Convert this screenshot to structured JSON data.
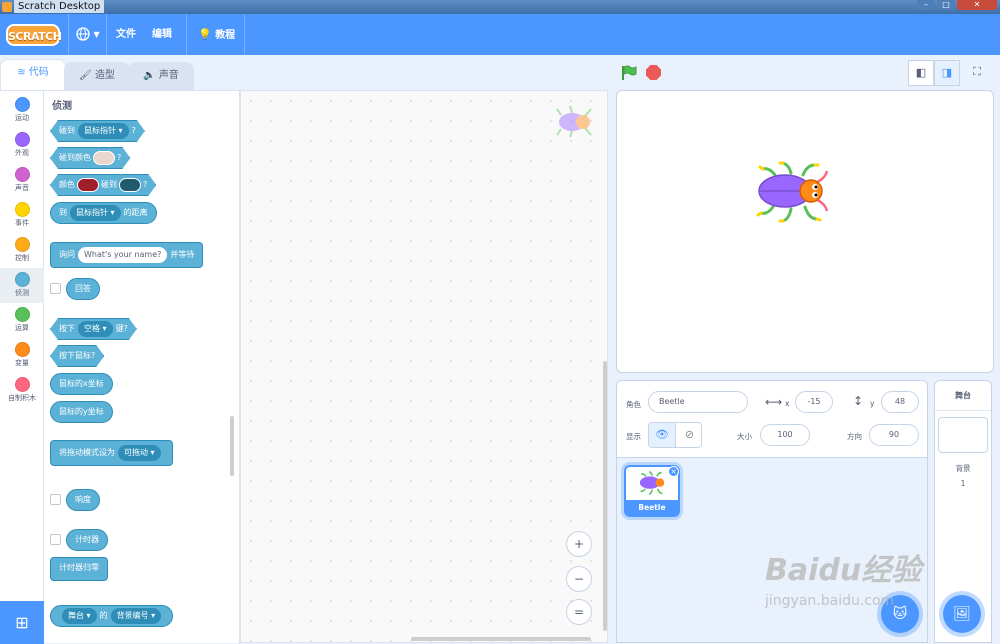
{
  "window": {
    "title": "Scratch Desktop"
  },
  "menu": {
    "logo": "SCRATCH",
    "language_icon": "globe-icon",
    "file": "文件",
    "edit": "编辑",
    "tutorials": "教程"
  },
  "tabs": {
    "code": "代码",
    "costumes": "造型",
    "sounds": "声音"
  },
  "categories": [
    {
      "label": "运动",
      "color": "#4c97ff"
    },
    {
      "label": "外观",
      "color": "#9966ff"
    },
    {
      "label": "声音",
      "color": "#cf63cf"
    },
    {
      "label": "事件",
      "color": "#ffd500"
    },
    {
      "label": "控制",
      "color": "#ffab19"
    },
    {
      "label": "侦测",
      "color": "#5cb1d6"
    },
    {
      "label": "运算",
      "color": "#59c059"
    },
    {
      "label": "变量",
      "color": "#ff8c1a"
    },
    {
      "label": "自制积木",
      "color": "#ff6680"
    }
  ],
  "palette": {
    "section_title": "侦测",
    "touching": {
      "prefix": "碰到",
      "menu": "鼠标指针",
      "suffix": "?"
    },
    "touching_color": {
      "prefix": "碰到颜色",
      "suffix": "?",
      "swatch": "#e8d6cf"
    },
    "color_touching": {
      "prefix": "颜色",
      "mid": "碰到",
      "suffix": "?",
      "swatch1": "#a01e2a",
      "swatch2": "#1f5a6e"
    },
    "distance": {
      "prefix": "到",
      "menu": "鼠标指针",
      "suffix": "的距离"
    },
    "ask": {
      "prefix": "询问",
      "input": "What's your name?",
      "suffix": "并等待"
    },
    "answer": "回答",
    "key_pressed": {
      "prefix": "按下",
      "menu": "空格",
      "suffix": "键?"
    },
    "mouse_down": "按下鼠标?",
    "mouse_x": "鼠标的x坐标",
    "mouse_y": "鼠标的y坐标",
    "drag_mode": {
      "prefix": "将拖动模式设为",
      "menu": "可拖动"
    },
    "loudness": "响度",
    "timer": "计时器",
    "reset_timer": "计时器归零",
    "of": {
      "menu1": "舞台",
      "mid": "的",
      "menu2": "背景编号"
    }
  },
  "workspace": {
    "zoom_in": "+",
    "zoom_out": "−",
    "zoom_reset": "="
  },
  "sprite_info": {
    "sprite_label": "角色",
    "sprite_name": "Beetle",
    "x_label": "x",
    "x_value": "-15",
    "y_label": "y",
    "y_value": "48",
    "show_label": "显示",
    "size_label": "大小",
    "size_value": "100",
    "direction_label": "方向",
    "direction_value": "90"
  },
  "sprites": [
    {
      "name": "Beetle",
      "selected": true
    }
  ],
  "stage_pane": {
    "title": "舞台",
    "backdrops_label": "背景",
    "backdrops_count": "1"
  },
  "watermark": {
    "line1": "Baidu经验",
    "line2": "jingyan.baidu.com"
  },
  "colors": {
    "accent": "#4c97ff",
    "sensing": "#5cb1d6",
    "stop": "#ec5959",
    "go": "#4cbf56"
  }
}
